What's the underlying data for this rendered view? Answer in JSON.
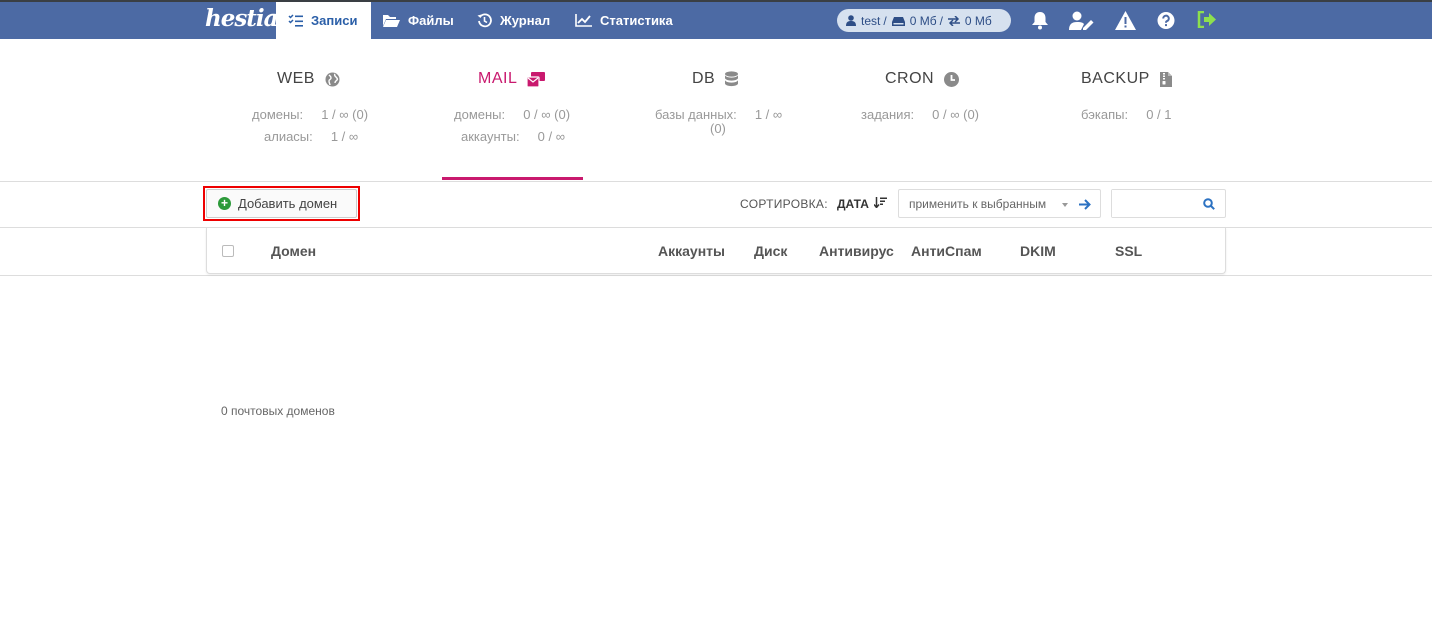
{
  "brand": {
    "logo": "hestia"
  },
  "nav": {
    "records": "Записи",
    "files": "Файлы",
    "log": "Журнал",
    "stats": "Статистика"
  },
  "user": {
    "name": "test",
    "disk": "0 Мб",
    "bandwidth": "0 Мб"
  },
  "stats": {
    "web": {
      "title": "WEB",
      "rows": [
        {
          "label": "домены:",
          "value": "1 / ∞ (0)"
        },
        {
          "label": "алиасы:",
          "value": "1 / ∞"
        }
      ]
    },
    "mail": {
      "title": "MAIL",
      "rows": [
        {
          "label": "домены:",
          "value": "0 / ∞ (0)"
        },
        {
          "label": "аккаунты:",
          "value": "0 / ∞"
        }
      ]
    },
    "db": {
      "title": "DB",
      "rows": [
        {
          "label": "базы данных:",
          "value": "1 / ∞"
        },
        {
          "label": "",
          "value": "(0)"
        }
      ]
    },
    "cron": {
      "title": "CRON",
      "rows": [
        {
          "label": "задания:",
          "value": "0 / ∞ (0)"
        }
      ]
    },
    "backup": {
      "title": "BACKUP",
      "rows": [
        {
          "label": "бэкапы:",
          "value": "0 / 1"
        }
      ]
    }
  },
  "toolbar": {
    "add_domain": "Добавить домен",
    "sort_label": "СОРТИРОВКА:",
    "sort_value": "ДАТА",
    "apply_selected": "применить к выбранным",
    "search_placeholder": ""
  },
  "table": {
    "headers": [
      "Домен",
      "Аккаунты",
      "Диск",
      "Антивирус",
      "АнтиСпам",
      "DKIM",
      "SSL"
    ]
  },
  "footer": {
    "count_text": "0 почтовых доменов"
  },
  "colors": {
    "topbar": "#4c6aa4",
    "accent": "#c9196e",
    "add_icon": "#2c9a3a",
    "highlight": "#ee0000"
  }
}
